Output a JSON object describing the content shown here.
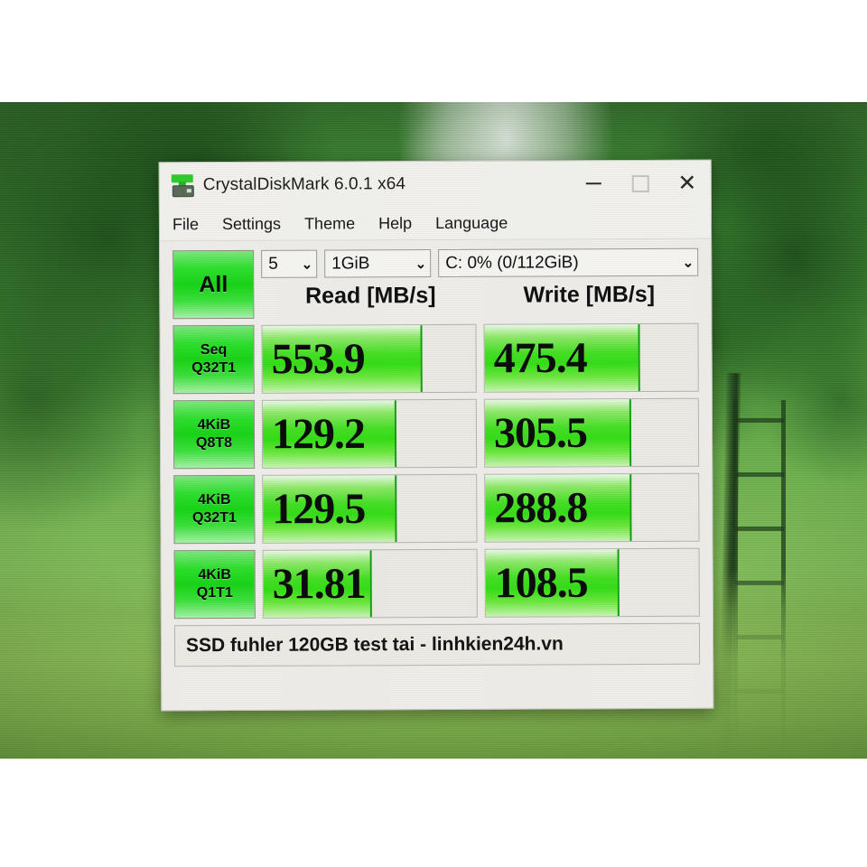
{
  "window": {
    "title": "CrystalDiskMark 6.0.1 x64",
    "app_icon": "disk-drive-icon",
    "controls": {
      "minimize": "minimize-icon",
      "maximize": "maximize-icon",
      "close": "close-icon"
    }
  },
  "menu": {
    "items": [
      {
        "label": "File"
      },
      {
        "label": "Settings"
      },
      {
        "label": "Theme"
      },
      {
        "label": "Help"
      },
      {
        "label": "Language"
      }
    ]
  },
  "toolbar": {
    "all_button": "All",
    "run_count": "5",
    "test_size": "1GiB",
    "target_drive": "C: 0% (0/112GiB)",
    "caret": "⌄"
  },
  "headers": {
    "read": "Read [MB/s]",
    "write": "Write [MB/s]"
  },
  "comment": "SSD fuhler 120GB test tai  -  linhkien24h.vn",
  "colors": {
    "accent_green": "#35dd18",
    "button_green": "#19d419",
    "window_bg": "#efeeea",
    "bar_track": "#eceae4"
  },
  "chart_data": {
    "type": "bar",
    "title": "CrystalDiskMark 6.0.1 x64 benchmark results",
    "xlabel": "",
    "ylabel": "MB/s",
    "unit": "MB/s",
    "categories": [
      "Seq Q32T1",
      "4KiB Q8T8",
      "4KiB Q32T1",
      "4KiB Q1T1"
    ],
    "series": [
      {
        "name": "Read [MB/s]",
        "values": [
          553.9,
          129.2,
          129.5,
          31.81
        ]
      },
      {
        "name": "Write [MB/s]",
        "values": [
          475.4,
          305.5,
          288.8,
          108.5
        ]
      }
    ],
    "legend_position": "top",
    "grid": false
  },
  "rows": [
    {
      "label_line1": "Seq",
      "label_line2": "Q32T1",
      "read": {
        "value": "553.9",
        "fill_pct": 74
      },
      "write": {
        "value": "475.4",
        "fill_pct": 72
      }
    },
    {
      "label_line1": "4KiB",
      "label_line2": "Q8T8",
      "read": {
        "value": "129.2",
        "fill_pct": 62
      },
      "write": {
        "value": "305.5",
        "fill_pct": 68
      }
    },
    {
      "label_line1": "4KiB",
      "label_line2": "Q32T1",
      "read": {
        "value": "129.5",
        "fill_pct": 62
      },
      "write": {
        "value": "288.8",
        "fill_pct": 68
      }
    },
    {
      "label_line1": "4KiB",
      "label_line2": "Q1T1",
      "read": {
        "value": "31.81",
        "fill_pct": 50
      },
      "write": {
        "value": "108.5",
        "fill_pct": 62
      }
    }
  ]
}
